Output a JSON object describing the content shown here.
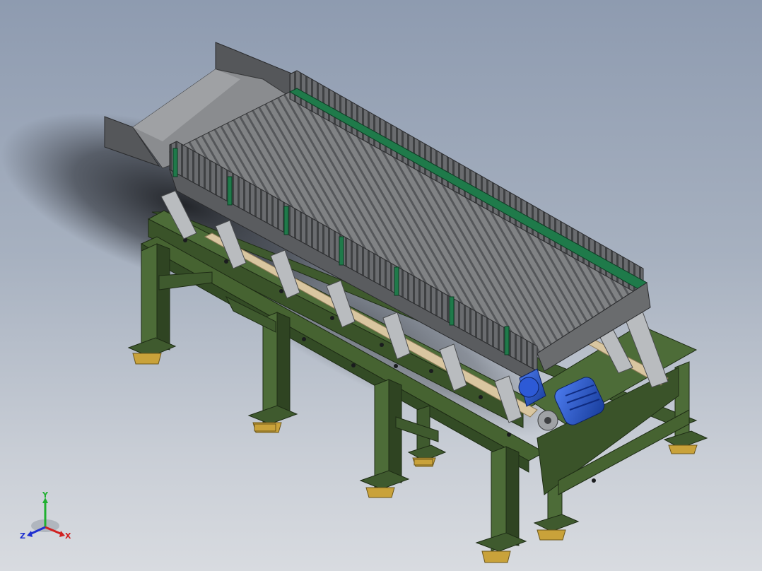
{
  "app": {
    "view": "isometric-model-viewport"
  },
  "colors": {
    "frame": "#3f5a2e",
    "frame_dark": "#2a3d1f",
    "frame_light": "#587a40",
    "slat": "#7d7f80",
    "slat_dark": "#4c4e50",
    "hopper": "#6a6c6e",
    "strip": "#1f7a4a",
    "motor": "#1f4fc6",
    "pad": "#c9a23a",
    "wood": "#d9c6a0"
  },
  "triad": {
    "x_label": "X",
    "y_label": "Y",
    "z_label": "Z",
    "x_color": "#d02020",
    "y_color": "#20b030",
    "z_color": "#2030d0"
  }
}
